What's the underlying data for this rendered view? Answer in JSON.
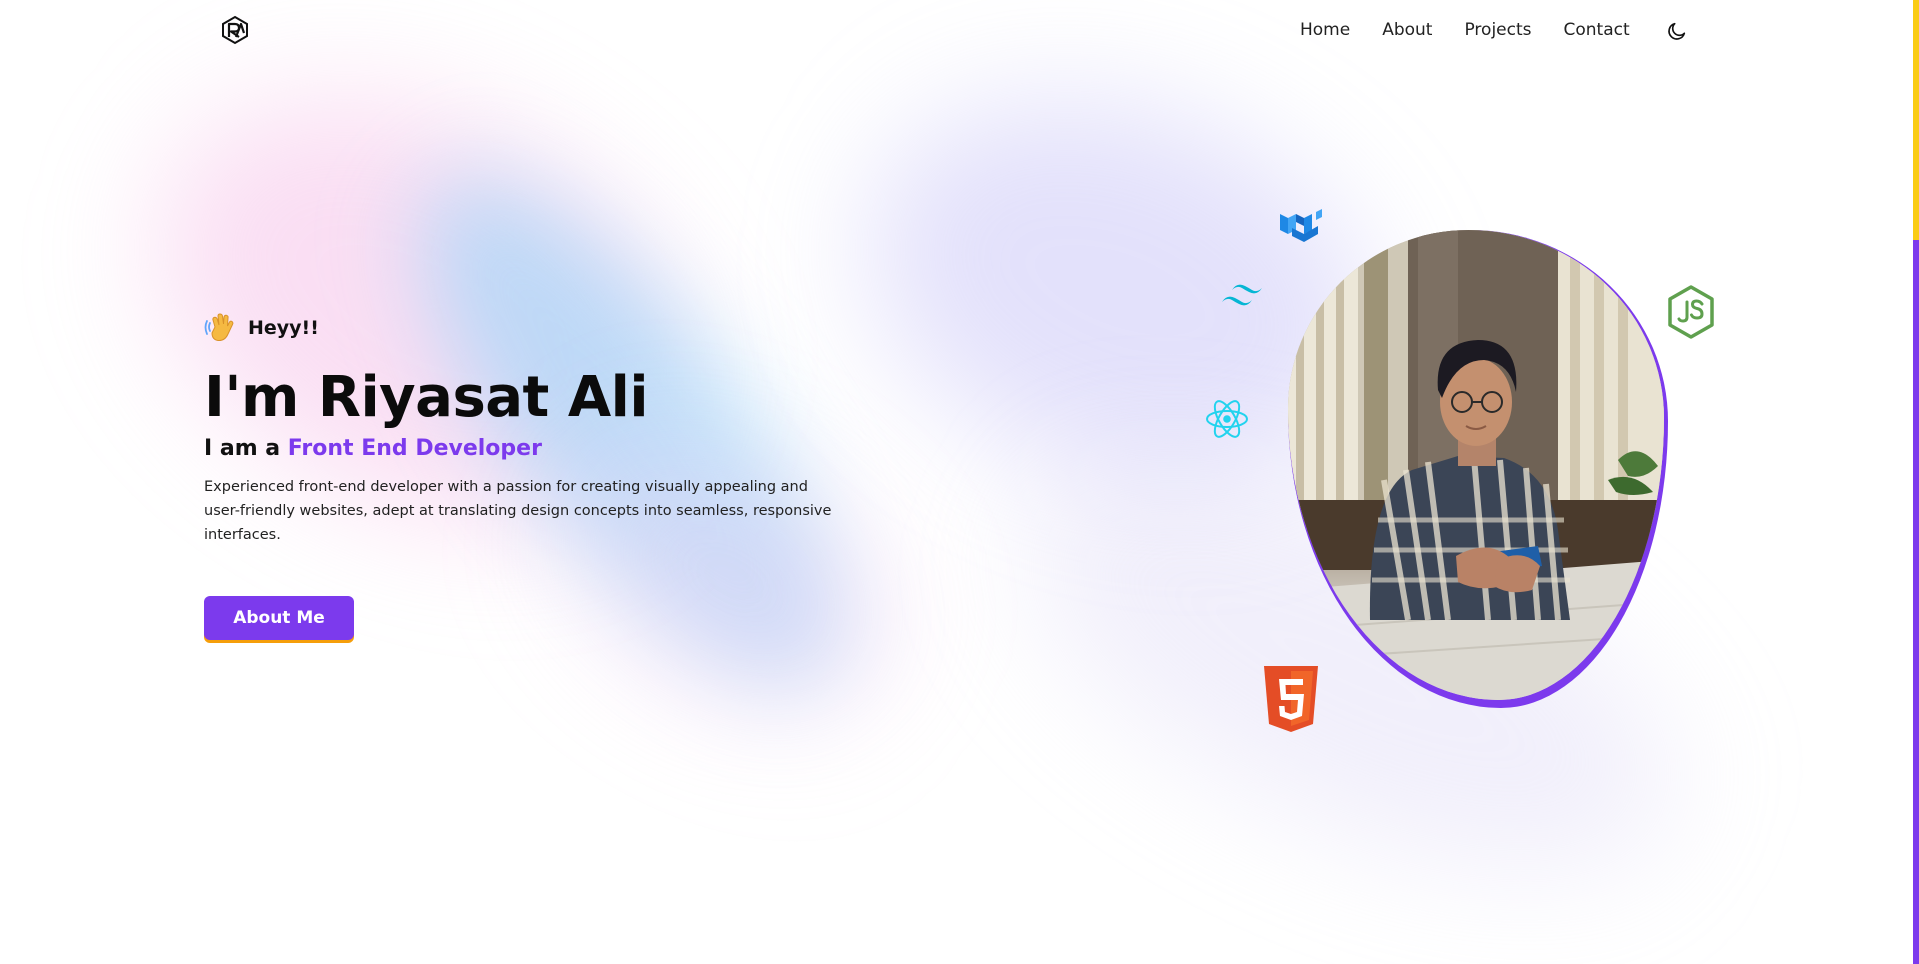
{
  "nav": {
    "logo_icon": "ra-logo-icon",
    "links": [
      "Home",
      "About",
      "Projects",
      "Contact"
    ],
    "theme_toggle_icon": "moon-icon"
  },
  "hero": {
    "greeting_icon": "waving-hand-icon",
    "greeting": "Heyy!!",
    "title": "I'm Riyasat Ali",
    "subtitle_prefix": "I am a",
    "role": "Front End Developer",
    "description": "Experienced front-end developer with a passion for creating visually appealing and user-friendly websites, adept at translating design concepts into seamless, responsive interfaces.",
    "cta_label": "About Me"
  },
  "profile": {
    "photo": "profile-photo-man-with-phone"
  },
  "tech_icons": [
    "mui-icon",
    "tailwind-icon",
    "react-icon",
    "nodejs-icon",
    "html5-icon"
  ],
  "colors": {
    "accent": "#7c3aed",
    "cta_underline": "#f59e0b",
    "scroll_thumb": "#facc15"
  }
}
